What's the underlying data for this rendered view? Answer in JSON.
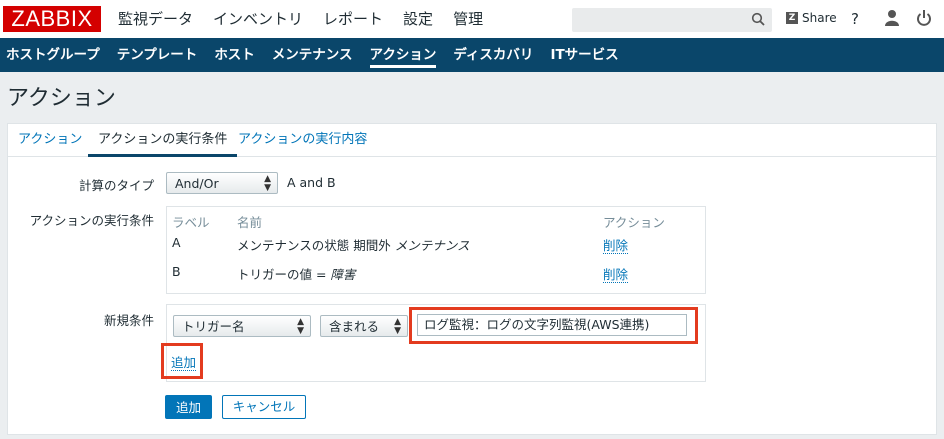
{
  "header": {
    "logo": "ZABBIX",
    "menu": [
      "監視データ",
      "インベントリ",
      "レポート",
      "設定",
      "管理"
    ],
    "search_placeholder": "",
    "share_label": "Share",
    "share_badge": "Z",
    "help_label": "?"
  },
  "submenu": {
    "items": [
      "ホストグループ",
      "テンプレート",
      "ホスト",
      "メンテナンス",
      "アクション",
      "ディスカバリ",
      "ITサービス"
    ],
    "active_index": 4
  },
  "page": {
    "title": "アクション"
  },
  "tabs": [
    "アクション",
    "アクションの実行条件",
    "アクションの実行内容"
  ],
  "form": {
    "calc_type": {
      "label": "計算のタイプ",
      "value": "And/Or",
      "expression": "A and B"
    },
    "conditions": {
      "label": "アクションの実行条件",
      "headers": {
        "label": "ラベル",
        "name": "名前",
        "action": "アクション"
      },
      "rows": [
        {
          "label": "A",
          "name_prefix": "メンテナンスの状態 期間外 ",
          "name_em": "メンテナンス",
          "action": "削除"
        },
        {
          "label": "B",
          "name_prefix": "トリガーの値 = ",
          "name_em": "障害",
          "action": "削除"
        }
      ]
    },
    "new_condition": {
      "label": "新規条件",
      "type_value": "トリガー名",
      "operator_value": "含まれる",
      "text_value": "ログ監視：ログの文字列監視(AWS連携)",
      "add_link": "追加"
    },
    "buttons": {
      "add": "追加",
      "cancel": "キャンセル"
    }
  },
  "colors": {
    "brand_red": "#d40000",
    "nav_blue": "#0a466a",
    "link_blue": "#0275b8",
    "highlight_red": "#e33b1f"
  }
}
